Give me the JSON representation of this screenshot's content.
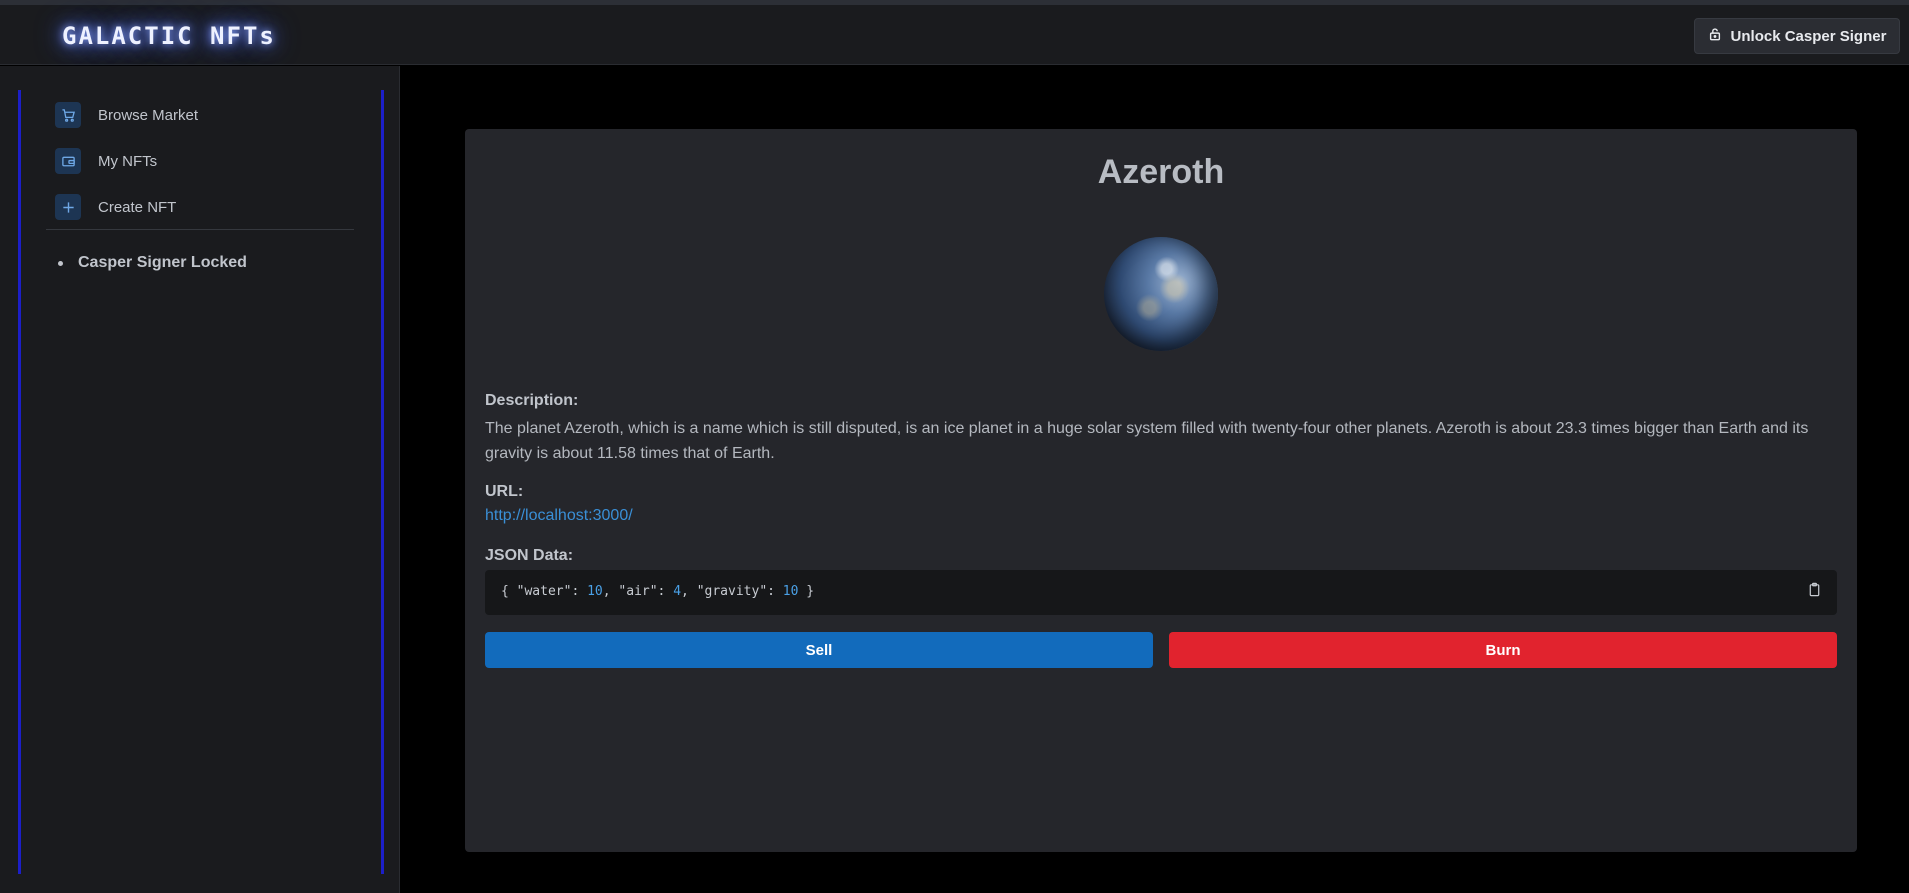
{
  "header": {
    "logo": "GALACTIC NFTs",
    "unlock_label": "Unlock Casper Signer"
  },
  "sidebar": {
    "items": [
      {
        "label": "Browse Market",
        "icon": "cart-icon"
      },
      {
        "label": "My NFTs",
        "icon": "wallet-icon"
      },
      {
        "label": "Create NFT",
        "icon": "plus-icon"
      }
    ],
    "status": "Casper Signer Locked"
  },
  "nft": {
    "title": "Azeroth",
    "description_label": "Description:",
    "description": "The planet Azeroth, which is a name which is still disputed, is an ice planet in a huge solar system filled with twenty-four other planets. Azeroth is about 23.3 times bigger than Earth and its gravity is about 11.58 times that of Earth.",
    "url_label": "URL:",
    "url": "http://localhost:3000/",
    "json_label": "JSON Data:",
    "json": {
      "open": "{ ",
      "k1": "\"water\": ",
      "v1": "10",
      "sep1": ", ",
      "k2": "\"air\": ",
      "v2": "4",
      "sep2": ", ",
      "k3": "\"gravity\": ",
      "v3": "10",
      "close": " }"
    },
    "sell_label": "Sell",
    "burn_label": "Burn"
  },
  "colors": {
    "accent_blue": "#126bbc",
    "danger_red": "#e1232e",
    "link": "#3a8fd6",
    "sidebar_border": "#1c1fc8"
  }
}
